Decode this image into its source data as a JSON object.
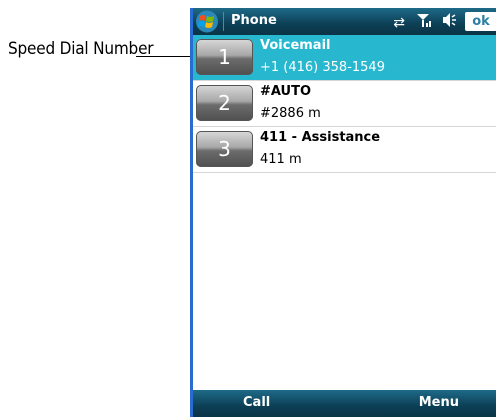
{
  "callout": {
    "label": "Speed Dial Number"
  },
  "titlebar": {
    "title": "Phone",
    "ok_label": "ok"
  },
  "speed_dial": [
    {
      "number": "1",
      "name": "Voicemail",
      "phone": "+1 (416) 358-1549",
      "selected": true
    },
    {
      "number": "2",
      "name": "#AUTO",
      "phone": "#2886 m",
      "selected": false
    },
    {
      "number": "3",
      "name": "411 - Assistance",
      "phone": "411 m",
      "selected": false
    }
  ],
  "softkeys": {
    "left": "Call",
    "right": "Menu"
  },
  "colors": {
    "selection": "#27b7ce",
    "bar": "#0c3f55",
    "ok_text": "#2c7fa6"
  },
  "icons": {
    "start": "windows-start-icon",
    "connectivity": "sync-arrows-icon",
    "signal": "signal-icon",
    "volume": "speaker-icon"
  }
}
